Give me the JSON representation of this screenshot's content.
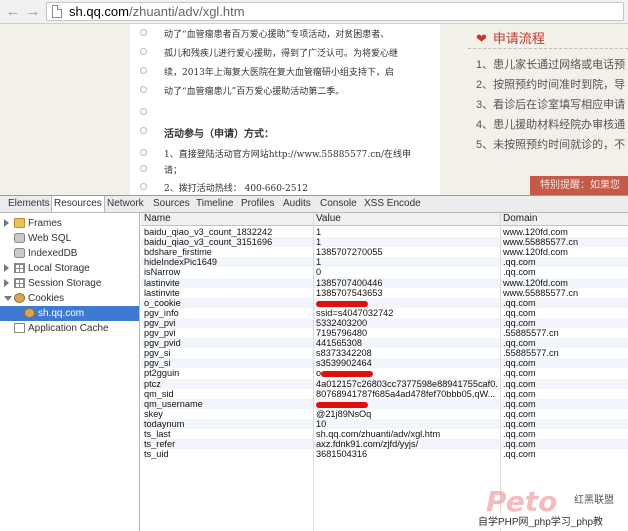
{
  "browser": {
    "url_domain": "sh.qq.com",
    "url_path": "/zhuanti/adv/xgl.htm",
    "back_icon": "back-arrow-icon",
    "forward_icon": "forward-arrow-icon"
  },
  "article": {
    "lines": [
      "动了“血管瘤患者百万爱心援助”专项活动，对贫困患者、",
      "孤儿和残疾儿进行爱心援助，得到了广泛认可。为将爱心继",
      "续，2013年上海复大医院在复大血管瘤研小组支持下，启",
      "动了“血管瘤患儿”百万爱心援助活动第二季。"
    ],
    "section_title": "活动参与（申请）方式：",
    "items": [
      "1、直接登陆活动官方网站http://www.55885577.cn/在线申",
      "请；",
      "2、拨打活动热线： 400-660-2512"
    ]
  },
  "sidebar": {
    "title": "申请流程",
    "steps": [
      "1、患儿家长通过网络或电话预",
      "2、按照预约时间准时到院，导",
      "3、看诊后在诊室填写相应申请",
      "4、患儿援助材料经院办审核通",
      "5、未按照预约时间就诊的，不"
    ],
    "banner": "特别提醒：如果您"
  },
  "devtools": {
    "tabs": [
      "Elements",
      "Resources",
      "Network",
      "Sources",
      "Timeline",
      "Profiles",
      "Audits",
      "Console",
      "XSS Encode"
    ],
    "active_tab": "Resources",
    "tree": [
      {
        "label": "Frames",
        "icon": "folder-icon",
        "expander": "right"
      },
      {
        "label": "Web SQL",
        "icon": "database-icon",
        "expander": "none"
      },
      {
        "label": "IndexedDB",
        "icon": "database-icon",
        "expander": "none"
      },
      {
        "label": "Local Storage",
        "icon": "grid-icon",
        "expander": "right"
      },
      {
        "label": "Session Storage",
        "icon": "grid-icon",
        "expander": "right"
      },
      {
        "label": "Cookies",
        "icon": "cookie-icon",
        "expander": "down"
      },
      {
        "label": "sh.qq.com",
        "icon": "cookie-icon",
        "expander": "none",
        "selected": true
      },
      {
        "label": "Application Cache",
        "icon": "page-icon",
        "expander": "none"
      }
    ],
    "columns": {
      "name": "Name",
      "value": "Value",
      "domain": "Domain"
    },
    "rows": [
      {
        "name": "baidu_qiao_v3_count_1832242",
        "value": "1",
        "domain": "www.120fd.com"
      },
      {
        "name": "baidu_qiao_v3_count_3151696",
        "value": "1",
        "domain": "www.55885577.cn"
      },
      {
        "name": "bdshare_firstime",
        "value": "1385707270055",
        "domain": "www.120fd.com"
      },
      {
        "name": "hideIndexPic1649",
        "value": "1",
        "domain": ".qq.com"
      },
      {
        "name": "isNarrow",
        "value": "0",
        "domain": ".qq.com"
      },
      {
        "name": "lastinvite",
        "value": "1385707400446",
        "domain": "www.120fd.com"
      },
      {
        "name": "lastinvite",
        "value": "1385707543653",
        "domain": "www.55885577.cn"
      },
      {
        "name": "o_cookie",
        "value": "",
        "domain": ".qq.com",
        "redacted": true
      },
      {
        "name": "pgv_info",
        "value": "ssid=s4047032742",
        "domain": ".qq.com"
      },
      {
        "name": "pgv_pvi",
        "value": "5332403200",
        "domain": ".qq.com"
      },
      {
        "name": "pgv_pvi",
        "value": "7195796480",
        "domain": ".55885577.cn"
      },
      {
        "name": "pgv_pvid",
        "value": "441565308",
        "domain": ".qq.com"
      },
      {
        "name": "pgv_si",
        "value": "s8373342208",
        "domain": ".55885577.cn"
      },
      {
        "name": "pgv_si",
        "value": "s3539902464",
        "domain": ".qq.com"
      },
      {
        "name": "pt2gguin",
        "value": "o",
        "domain": ".qq.com",
        "redacted": true
      },
      {
        "name": "ptcz",
        "value": "4a012157c26803cc7377598e88941755caf0...",
        "domain": ".qq.com"
      },
      {
        "name": "qm_sid",
        "value": "80768941787f685a4ad478fef70bbb05,qW...",
        "domain": ".qq.com"
      },
      {
        "name": "qm_username",
        "value": "",
        "domain": ".qq.com",
        "redacted": true
      },
      {
        "name": "skey",
        "value": "@21j89NsOq",
        "domain": ".qq.com"
      },
      {
        "name": "todaynum",
        "value": "10",
        "domain": ".qq.com"
      },
      {
        "name": "ts_last",
        "value": "sh.qq.com/zhuanti/adv/xgl.htm",
        "domain": ".qq.com"
      },
      {
        "name": "ts_refer",
        "value": "axz.fdnk91.com/zjfd/yyjs/",
        "domain": ".qq.com"
      },
      {
        "name": "ts_uid",
        "value": "3681504316",
        "domain": ".qq.com"
      }
    ]
  },
  "watermark": {
    "badge": "红黑联盟",
    "text": "自学PHP网_php学习_php教"
  }
}
